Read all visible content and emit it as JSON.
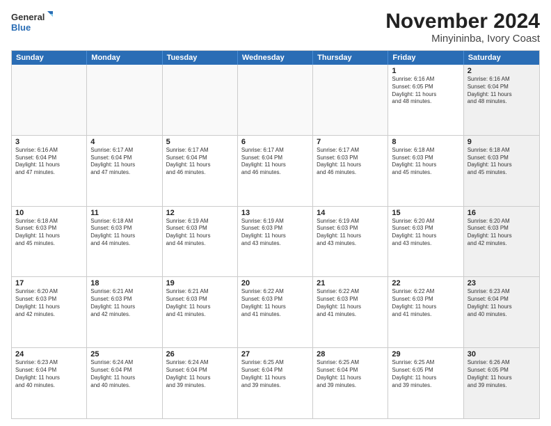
{
  "logo": {
    "line1": "General",
    "line2": "Blue"
  },
  "title": "November 2024",
  "subtitle": "Minyininba, Ivory Coast",
  "days_of_week": [
    "Sunday",
    "Monday",
    "Tuesday",
    "Wednesday",
    "Thursday",
    "Friday",
    "Saturday"
  ],
  "weeks": [
    [
      {
        "day": "",
        "info": "",
        "shaded": false,
        "empty": true
      },
      {
        "day": "",
        "info": "",
        "shaded": false,
        "empty": true
      },
      {
        "day": "",
        "info": "",
        "shaded": false,
        "empty": true
      },
      {
        "day": "",
        "info": "",
        "shaded": false,
        "empty": true
      },
      {
        "day": "",
        "info": "",
        "shaded": false,
        "empty": true
      },
      {
        "day": "1",
        "info": "Sunrise: 6:16 AM\nSunset: 6:05 PM\nDaylight: 11 hours\nand 48 minutes.",
        "shaded": false,
        "empty": false
      },
      {
        "day": "2",
        "info": "Sunrise: 6:16 AM\nSunset: 6:04 PM\nDaylight: 11 hours\nand 48 minutes.",
        "shaded": true,
        "empty": false
      }
    ],
    [
      {
        "day": "3",
        "info": "Sunrise: 6:16 AM\nSunset: 6:04 PM\nDaylight: 11 hours\nand 47 minutes.",
        "shaded": false,
        "empty": false
      },
      {
        "day": "4",
        "info": "Sunrise: 6:17 AM\nSunset: 6:04 PM\nDaylight: 11 hours\nand 47 minutes.",
        "shaded": false,
        "empty": false
      },
      {
        "day": "5",
        "info": "Sunrise: 6:17 AM\nSunset: 6:04 PM\nDaylight: 11 hours\nand 46 minutes.",
        "shaded": false,
        "empty": false
      },
      {
        "day": "6",
        "info": "Sunrise: 6:17 AM\nSunset: 6:04 PM\nDaylight: 11 hours\nand 46 minutes.",
        "shaded": false,
        "empty": false
      },
      {
        "day": "7",
        "info": "Sunrise: 6:17 AM\nSunset: 6:03 PM\nDaylight: 11 hours\nand 46 minutes.",
        "shaded": false,
        "empty": false
      },
      {
        "day": "8",
        "info": "Sunrise: 6:18 AM\nSunset: 6:03 PM\nDaylight: 11 hours\nand 45 minutes.",
        "shaded": false,
        "empty": false
      },
      {
        "day": "9",
        "info": "Sunrise: 6:18 AM\nSunset: 6:03 PM\nDaylight: 11 hours\nand 45 minutes.",
        "shaded": true,
        "empty": false
      }
    ],
    [
      {
        "day": "10",
        "info": "Sunrise: 6:18 AM\nSunset: 6:03 PM\nDaylight: 11 hours\nand 45 minutes.",
        "shaded": false,
        "empty": false
      },
      {
        "day": "11",
        "info": "Sunrise: 6:18 AM\nSunset: 6:03 PM\nDaylight: 11 hours\nand 44 minutes.",
        "shaded": false,
        "empty": false
      },
      {
        "day": "12",
        "info": "Sunrise: 6:19 AM\nSunset: 6:03 PM\nDaylight: 11 hours\nand 44 minutes.",
        "shaded": false,
        "empty": false
      },
      {
        "day": "13",
        "info": "Sunrise: 6:19 AM\nSunset: 6:03 PM\nDaylight: 11 hours\nand 43 minutes.",
        "shaded": false,
        "empty": false
      },
      {
        "day": "14",
        "info": "Sunrise: 6:19 AM\nSunset: 6:03 PM\nDaylight: 11 hours\nand 43 minutes.",
        "shaded": false,
        "empty": false
      },
      {
        "day": "15",
        "info": "Sunrise: 6:20 AM\nSunset: 6:03 PM\nDaylight: 11 hours\nand 43 minutes.",
        "shaded": false,
        "empty": false
      },
      {
        "day": "16",
        "info": "Sunrise: 6:20 AM\nSunset: 6:03 PM\nDaylight: 11 hours\nand 42 minutes.",
        "shaded": true,
        "empty": false
      }
    ],
    [
      {
        "day": "17",
        "info": "Sunrise: 6:20 AM\nSunset: 6:03 PM\nDaylight: 11 hours\nand 42 minutes.",
        "shaded": false,
        "empty": false
      },
      {
        "day": "18",
        "info": "Sunrise: 6:21 AM\nSunset: 6:03 PM\nDaylight: 11 hours\nand 42 minutes.",
        "shaded": false,
        "empty": false
      },
      {
        "day": "19",
        "info": "Sunrise: 6:21 AM\nSunset: 6:03 PM\nDaylight: 11 hours\nand 41 minutes.",
        "shaded": false,
        "empty": false
      },
      {
        "day": "20",
        "info": "Sunrise: 6:22 AM\nSunset: 6:03 PM\nDaylight: 11 hours\nand 41 minutes.",
        "shaded": false,
        "empty": false
      },
      {
        "day": "21",
        "info": "Sunrise: 6:22 AM\nSunset: 6:03 PM\nDaylight: 11 hours\nand 41 minutes.",
        "shaded": false,
        "empty": false
      },
      {
        "day": "22",
        "info": "Sunrise: 6:22 AM\nSunset: 6:03 PM\nDaylight: 11 hours\nand 41 minutes.",
        "shaded": false,
        "empty": false
      },
      {
        "day": "23",
        "info": "Sunrise: 6:23 AM\nSunset: 6:04 PM\nDaylight: 11 hours\nand 40 minutes.",
        "shaded": true,
        "empty": false
      }
    ],
    [
      {
        "day": "24",
        "info": "Sunrise: 6:23 AM\nSunset: 6:04 PM\nDaylight: 11 hours\nand 40 minutes.",
        "shaded": false,
        "empty": false
      },
      {
        "day": "25",
        "info": "Sunrise: 6:24 AM\nSunset: 6:04 PM\nDaylight: 11 hours\nand 40 minutes.",
        "shaded": false,
        "empty": false
      },
      {
        "day": "26",
        "info": "Sunrise: 6:24 AM\nSunset: 6:04 PM\nDaylight: 11 hours\nand 39 minutes.",
        "shaded": false,
        "empty": false
      },
      {
        "day": "27",
        "info": "Sunrise: 6:25 AM\nSunset: 6:04 PM\nDaylight: 11 hours\nand 39 minutes.",
        "shaded": false,
        "empty": false
      },
      {
        "day": "28",
        "info": "Sunrise: 6:25 AM\nSunset: 6:04 PM\nDaylight: 11 hours\nand 39 minutes.",
        "shaded": false,
        "empty": false
      },
      {
        "day": "29",
        "info": "Sunrise: 6:25 AM\nSunset: 6:05 PM\nDaylight: 11 hours\nand 39 minutes.",
        "shaded": false,
        "empty": false
      },
      {
        "day": "30",
        "info": "Sunrise: 6:26 AM\nSunset: 6:05 PM\nDaylight: 11 hours\nand 39 minutes.",
        "shaded": true,
        "empty": false
      }
    ]
  ]
}
